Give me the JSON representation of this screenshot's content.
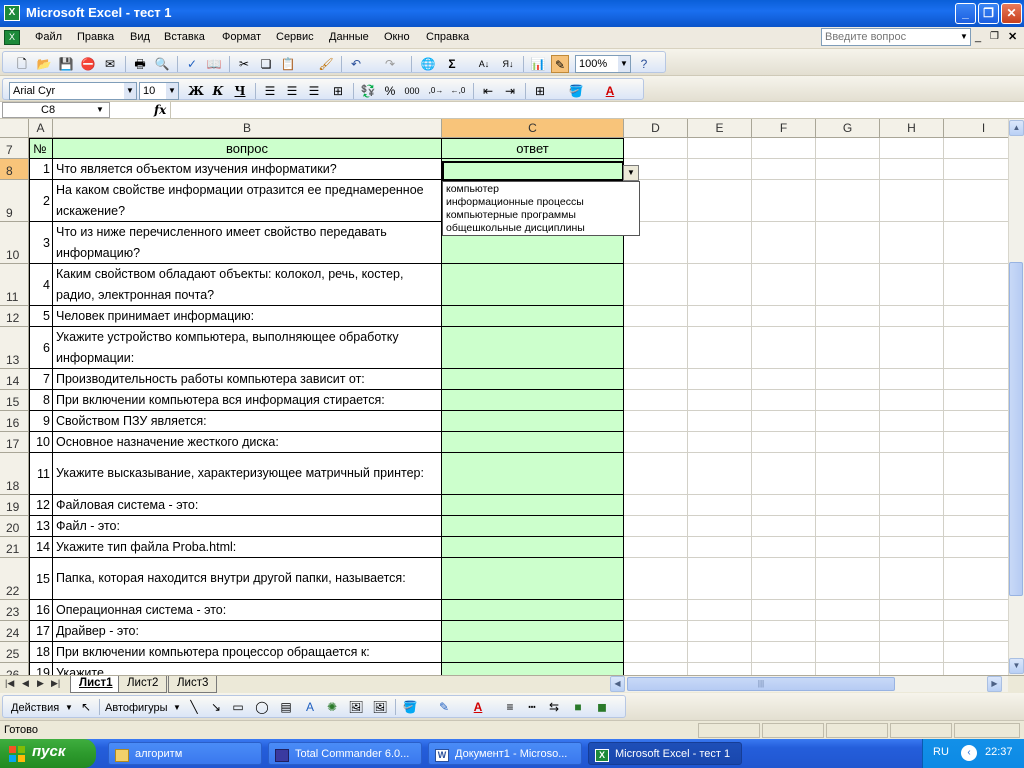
{
  "window": {
    "title": "Microsoft Excel - тест 1",
    "min_glyph": "_",
    "restore_glyph": "❐",
    "close_glyph": "✕"
  },
  "menu": {
    "items": [
      "Файл",
      "Правка",
      "Вид",
      "Вставка",
      "Формат",
      "Сервис",
      "Данные",
      "Окно",
      "Справка"
    ],
    "ask_placeholder": "Введите вопрос"
  },
  "toolbar_standard": {
    "zoom": "100%"
  },
  "toolbar_format": {
    "font_name": "Arial Cyr",
    "font_size": "10",
    "bold": "Ж",
    "italic": "К",
    "underline": "Ч"
  },
  "formula_bar": {
    "name_box": "C8",
    "fx": "fx",
    "content": ""
  },
  "sheet": {
    "columns": [
      "A",
      "B",
      "C",
      "D",
      "E",
      "F",
      "G",
      "H",
      "I"
    ],
    "selected_column": "C",
    "header_row": {
      "row": "7",
      "a": "№",
      "b": "вопрос",
      "c": "ответ"
    },
    "rows": [
      {
        "row": "8",
        "num": "1",
        "question": "Что является объектом изучения информатики?"
      },
      {
        "row": "9",
        "num": "2",
        "question": "На каком свойстве информации отразится ее преднамеренное искажение?"
      },
      {
        "row": "10",
        "num": "3",
        "question": "Что из ниже перечисленного имеет свойство передавать информацию?"
      },
      {
        "row": "11",
        "num": "4",
        "question": "Каким свойством обладают объекты: колокол, речь, костер, радио, электронная почта?"
      },
      {
        "row": "12",
        "num": "5",
        "question": "Человек принимает информацию:"
      },
      {
        "row": "13",
        "num": "6",
        "question": "Укажите устройство компьютера, выполняющее обработку информации:"
      },
      {
        "row": "14",
        "num": "7",
        "question": "Производительность работы компьютера зависит от:"
      },
      {
        "row": "15",
        "num": "8",
        "question": "При включении компьютера вся информация стирается:"
      },
      {
        "row": "16",
        "num": "9",
        "question": "Свойством ПЗУ является:"
      },
      {
        "row": "17",
        "num": "10",
        "question": "Основное назначение жесткого диска:"
      },
      {
        "row": "18",
        "num": "11",
        "question": "Укажите высказывание, характеризующее матричный принтер:"
      },
      {
        "row": "19",
        "num": "12",
        "question": "Файловая система - это:"
      },
      {
        "row": "20",
        "num": "13",
        "question": "Файл - это:"
      },
      {
        "row": "21",
        "num": "14",
        "question": "Укажите тип файла Proba.html:"
      },
      {
        "row": "22",
        "num": "15",
        "question": "Папка, которая находится внутри другой папки, называется:"
      },
      {
        "row": "23",
        "num": "16",
        "question": "Операционная система - это:"
      },
      {
        "row": "24",
        "num": "17",
        "question": "Драйвер - это:"
      },
      {
        "row": "25",
        "num": "18",
        "question": "При включении компьютера процессор обращается к:"
      },
      {
        "row": "26",
        "num": "19",
        "question": "Укажите ..."
      }
    ],
    "dropdown_options": [
      "компьютер",
      "информационные процессы",
      "компьютерные программы",
      "общешкольные дисциплины"
    ],
    "tabs": [
      "Лист1",
      "Лист2",
      "Лист3"
    ],
    "active_tab": "Лист1"
  },
  "drawing_toolbar": {
    "actions": "Действия",
    "autoshapes": "Автофигуры"
  },
  "status": {
    "text": "Готово"
  },
  "taskbar": {
    "start": "пуск",
    "tasks": [
      {
        "label": "алгоритм"
      },
      {
        "label": "Total Commander 6.0..."
      },
      {
        "label": "Документ1 - Microso..."
      },
      {
        "label": "Microsoft Excel - тест 1"
      }
    ],
    "lang": "RU",
    "clock": "22:37"
  },
  "colors": {
    "answer_fill": "#ccffcc",
    "selected_header": "#f8c47a",
    "title_bar": "#0a5fd8",
    "taskbar": "#245edb",
    "start_button": "#2d9a2d"
  }
}
